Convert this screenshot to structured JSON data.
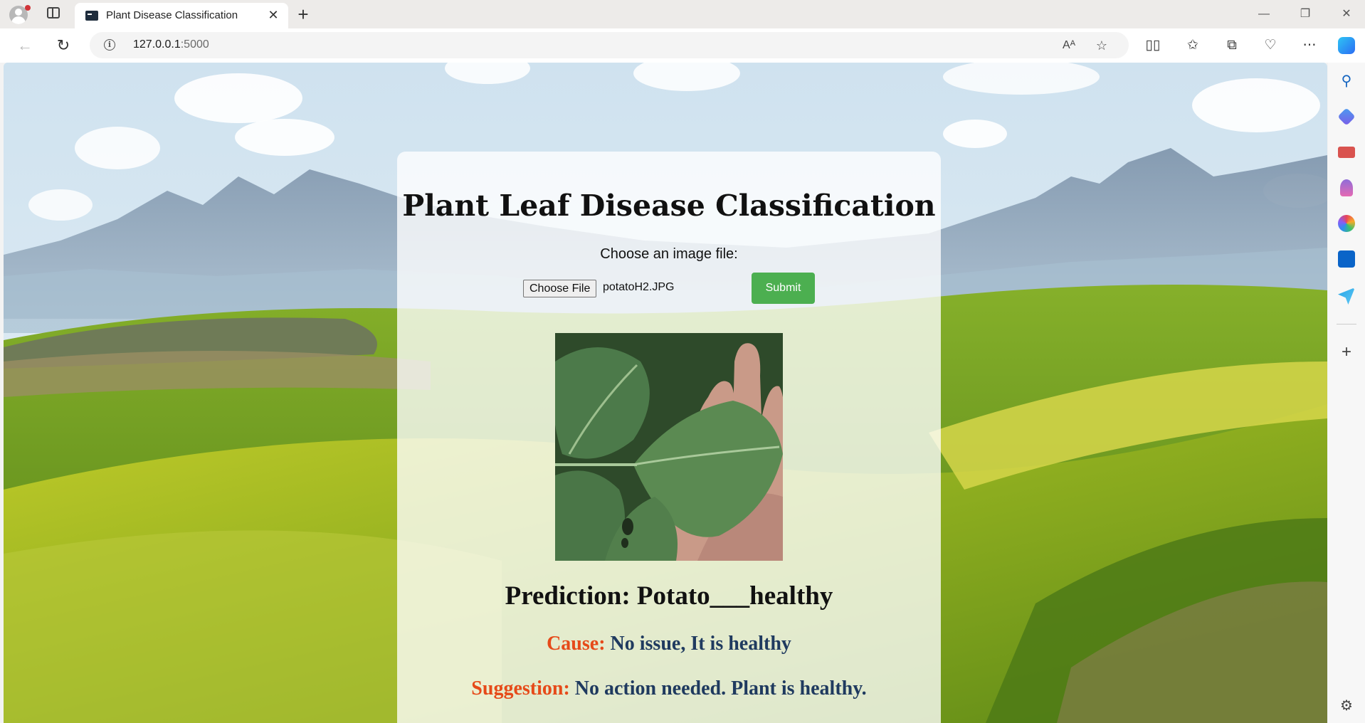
{
  "browser": {
    "tab_title": "Plant Disease Classification",
    "address_host": "127.0.0.1",
    "address_port": ":5000",
    "icons": [
      "profile-icon",
      "tab-actions-icon",
      "close-icon",
      "new-tab-icon",
      "back-icon",
      "refresh-icon",
      "info-icon",
      "read-aloud-icon",
      "favorite-icon",
      "split-screen-icon",
      "favorites-icon",
      "collections-icon",
      "performance-icon",
      "more-icon",
      "copilot-icon",
      "minimize-icon",
      "restore-icon",
      "window-close-icon"
    ],
    "read_aloud_glyph": "Aᴬ",
    "more_glyph": "⋯"
  },
  "sidebar": {
    "icons": [
      "search-icon",
      "shopping-icon",
      "tools-icon",
      "games-icon",
      "office-icon",
      "outlook-icon",
      "send-icon",
      "add-icon",
      "settings-icon"
    ]
  },
  "page": {
    "title": "Plant Leaf Disease Classification",
    "choose_label": "Choose an image file:",
    "choose_button": "Choose File",
    "file_name": "potatoH2.JPG",
    "submit_label": "Submit",
    "prediction": "Prediction: Potato___healthy",
    "cause_label": "Cause:",
    "cause_value": "No issue, It is healthy",
    "suggestion_label": "Suggestion:",
    "suggestion_value": "No action needed. Plant is healthy."
  },
  "colors": {
    "submit": "#4caf50",
    "result_label": "#e64a19",
    "result_value": "#1f3a5f"
  }
}
